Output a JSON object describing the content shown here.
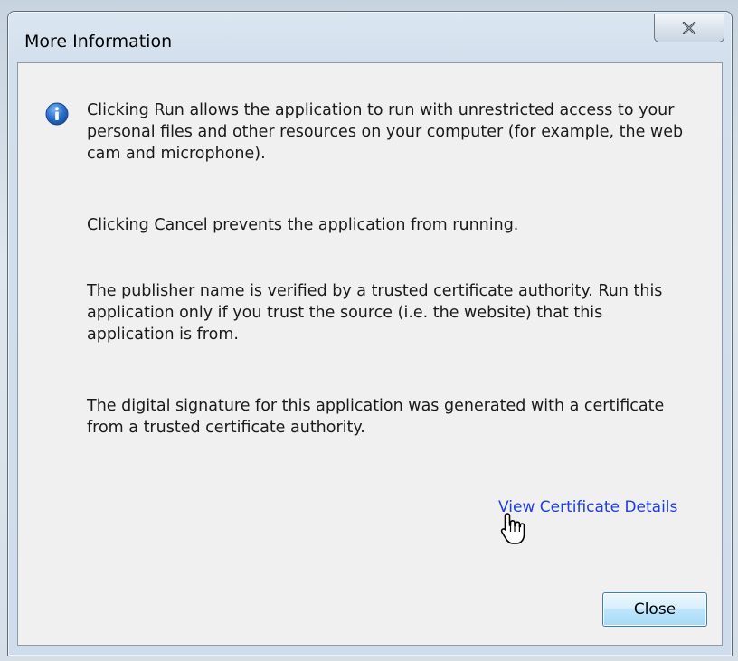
{
  "window": {
    "title": "More Information",
    "close_icon": "close-x-icon"
  },
  "content": {
    "info_icon": "info-icon",
    "paragraphs": [
      "Clicking Run allows the application to run with unrestricted access to your personal files and other resources on your computer (for example, the web cam and microphone).",
      "Clicking Cancel prevents the application from running.",
      "The publisher name is verified by a trusted certificate authority. Run this application only if you trust the source (i.e. the website) that this application is from.",
      "The digital signature for this application was generated with a certificate from a trusted certificate authority."
    ],
    "link_label": "View Certificate Details"
  },
  "footer": {
    "close_label": "Close"
  },
  "colors": {
    "link": "#1f3fdc",
    "info_icon": "#2a6fcf",
    "button_border": "#3c7fb1"
  }
}
